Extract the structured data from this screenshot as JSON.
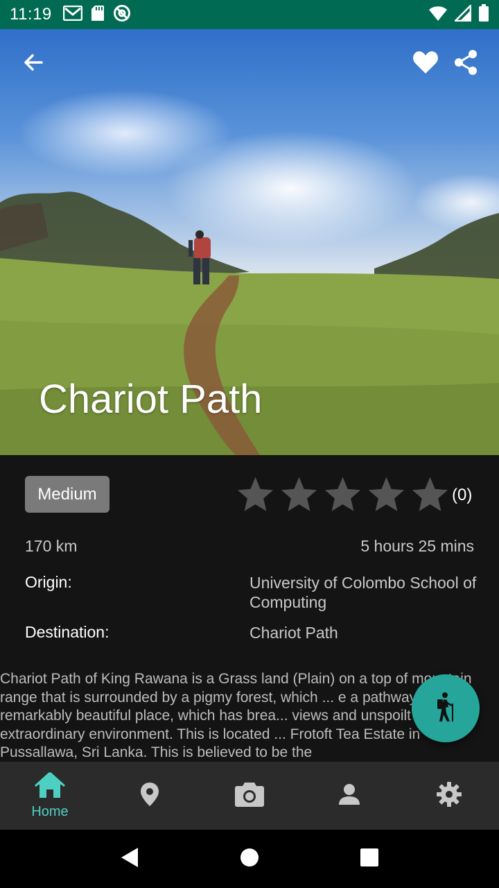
{
  "status_bar": {
    "time": "11:19",
    "left_icons": [
      "gmail-icon",
      "sd-card-icon",
      "no-disturb-icon"
    ],
    "right_icons": [
      "wifi-icon",
      "signal-icon",
      "battery-icon"
    ],
    "background": "#006b52"
  },
  "hero": {
    "title": "Chariot Path",
    "actions": [
      "back-arrow-icon",
      "heart-icon",
      "share-icon"
    ]
  },
  "details": {
    "difficulty": "Medium",
    "rating_stars": 0,
    "rating_max": 5,
    "rating_count": "(0)",
    "distance": "170 km",
    "duration": "5 hours 25 mins",
    "origin_label": "Origin:",
    "origin_value": "University of Colombo School of Computing",
    "destination_label": "Destination:",
    "destination_value": "Chariot Path",
    "description": "Chariot Path of King Rawana is a Grass land (Plain) on a top of mountain range that is surrounded by a pigmy forest, which ... e a pathway. It is a remarkably beautiful place, which has brea... views and unspoilt extraordinary environment. This is located ... Frotoft Tea Estate in Pussallawa, Sri Lanka. This is believed to be the"
  },
  "fab": {
    "icon": "hiker-icon",
    "color": "#26a69a"
  },
  "bottom_nav": {
    "items": [
      {
        "icon": "home-icon",
        "label": "Home",
        "active": true
      },
      {
        "icon": "location-pin-icon",
        "label": "",
        "active": false
      },
      {
        "icon": "camera-icon",
        "label": "",
        "active": false
      },
      {
        "icon": "person-icon",
        "label": "",
        "active": false
      },
      {
        "icon": "settings-gear-icon",
        "label": "",
        "active": false
      }
    ],
    "active_color": "#4dd0c1",
    "inactive_color": "#c8c8c8"
  },
  "system_nav": [
    "back-triangle-icon",
    "home-circle-icon",
    "recents-square-icon"
  ]
}
